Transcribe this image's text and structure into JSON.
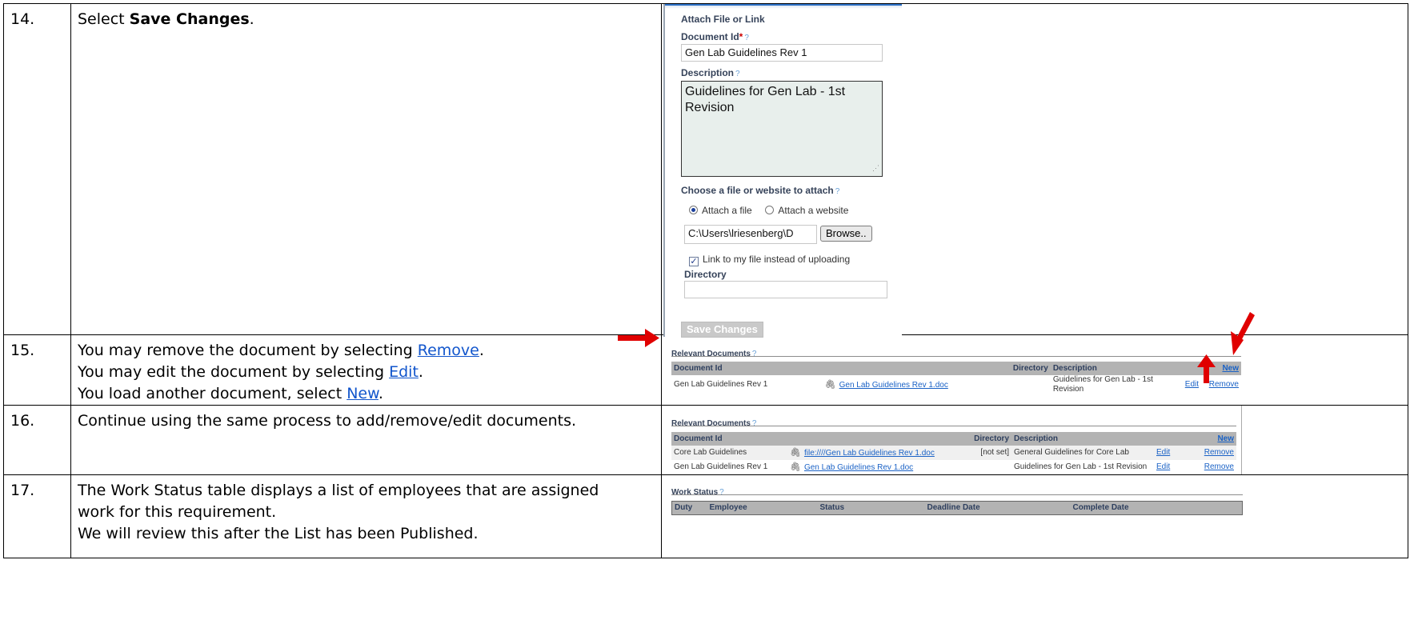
{
  "steps": [
    {
      "number": "14.",
      "text_pre": "Select ",
      "text_bold": "Save Changes",
      "text_post": "."
    },
    {
      "number": "15.",
      "line1_pre": "You may remove the document by selecting ",
      "line1_link": "Remove",
      "line2_pre": "You may edit the document by selecting ",
      "line2_link": "Edit",
      "line3_pre": "You load another document, select ",
      "line3_link": "New",
      "period": "."
    },
    {
      "number": "16.",
      "text": "Continue using the same process to add/remove/edit documents."
    },
    {
      "number": "17.",
      "line1": "The Work Status table displays a list of employees that are assigned",
      "line2": "work for this requirement.",
      "line3": "We will review this after the List has been Published."
    }
  ],
  "attach_form": {
    "title": "Attach File or Link",
    "doc_id_label": "Document Id",
    "required_mark": "*",
    "help_mark": "?",
    "doc_id_value": "Gen Lab Guidelines Rev 1",
    "description_label": "Description",
    "description_value": "Guidelines for Gen Lab - 1st Revision",
    "choose_label": "Choose a file or website to attach",
    "radio_file": "Attach a file",
    "radio_website": "Attach a website",
    "file_path": "C:\\Users\\lriesenberg\\D",
    "browse_label": "Browse..",
    "link_checkbox_label": "Link to my file instead of uploading",
    "link_checked": true,
    "directory_label": "Directory",
    "directory_value": "",
    "save_label": "Save Changes"
  },
  "relevant_docs_1": {
    "title": "Relevant Documents",
    "columns": [
      "Document Id",
      "",
      "Directory",
      "Description",
      "",
      "New"
    ],
    "rows": [
      {
        "doc_id": "Gen Lab Guidelines Rev 1",
        "file": "Gen Lab Guidelines Rev 1.doc",
        "directory": "",
        "description": "Guidelines for Gen Lab - 1st Revision",
        "edit": "Edit",
        "remove": "Remove"
      }
    ]
  },
  "relevant_docs_2": {
    "title": "Relevant Documents",
    "columns": [
      "Document Id",
      "",
      "Directory",
      "Description",
      "",
      "New"
    ],
    "rows": [
      {
        "doc_id": "Core Lab Guidelines",
        "file": "file:////Gen Lab Guidelines Rev 1.doc",
        "directory": "[not set]",
        "description": "General Guidelines for Core Lab",
        "edit": "Edit",
        "remove": "Remove"
      },
      {
        "doc_id": "Gen Lab Guidelines Rev 1",
        "file": "Gen Lab Guidelines Rev 1.doc",
        "directory": "",
        "description": "Guidelines for Gen Lab - 1st Revision",
        "edit": "Edit",
        "remove": "Remove"
      }
    ]
  },
  "work_status": {
    "title": "Work Status",
    "columns": [
      "Duty",
      "Employee",
      "Status",
      "Deadline Date",
      "Complete Date"
    ]
  },
  "colors": {
    "annotation_arrow": "#e00000",
    "link": "#1155cc",
    "table_header": "#b3b3b3"
  }
}
